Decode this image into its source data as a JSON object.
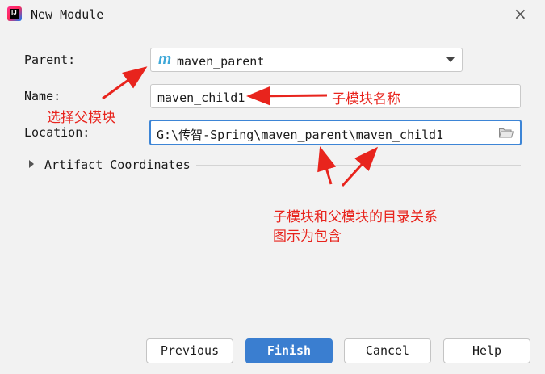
{
  "window": {
    "title": "New Module"
  },
  "form": {
    "parent_label": "Parent:",
    "parent_value": "maven_parent",
    "name_label": "Name:",
    "name_value": "maven_child1",
    "location_label": "Location:",
    "location_value": "G:\\传智-Spring\\maven_parent\\maven_child1",
    "artifact_label": "Artifact Coordinates"
  },
  "buttons": {
    "previous": "Previous",
    "finish": "Finish",
    "cancel": "Cancel",
    "help": "Help"
  },
  "annotations": {
    "select_parent": "选择父模块",
    "child_name": "子模块名称",
    "relation_line1": "子模块和父模块的目录关系",
    "relation_line2": "图示为包含"
  },
  "colors": {
    "accent": "#3a7ed0",
    "annotation": "#e8241d",
    "maven_icon": "#3ea8d8"
  },
  "icons": {
    "app": "intellij-idea-icon",
    "close": "close-icon",
    "parent": "maven-m-icon",
    "dropdown": "chevron-down-icon",
    "folder": "folder-icon",
    "expand": "triangle-right-icon"
  }
}
